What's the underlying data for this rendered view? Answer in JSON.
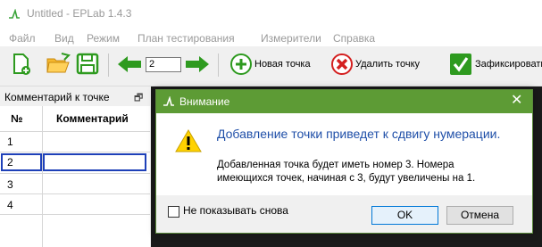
{
  "window": {
    "title": "Untitled - EPLab 1.4.3",
    "icon": "app-logo-icon"
  },
  "menu": [
    "Файл",
    "Вид",
    "Режим",
    "План тестирования",
    "Измерители",
    "Справка"
  ],
  "toolbar": {
    "step_value": "2",
    "add_point_label": "Новая точка",
    "delete_point_label": "Удалить точку",
    "fix_label": "Зафиксировать",
    "icons": [
      "new-file-icon",
      "open-folder-icon",
      "save-icon",
      "arrow-left-icon",
      "arrow-right-icon",
      "add-point-icon",
      "delete-point-icon",
      "checkmark-icon"
    ],
    "colors": {
      "green": "#2e9a1f",
      "red": "#d42020",
      "blue": "#1e40b8"
    }
  },
  "panel": {
    "title": "Комментарий к точке",
    "columns": [
      "№",
      "Комментарий"
    ],
    "rows": [
      {
        "num": "1",
        "comment": ""
      },
      {
        "num": "2",
        "comment": ""
      },
      {
        "num": "3",
        "comment": ""
      },
      {
        "num": "4",
        "comment": ""
      }
    ],
    "selected_row": 2
  },
  "dialog": {
    "title": "Внимание",
    "accent": "#5d9b35",
    "main_message": "Добавление точки приведет к сдвигу нумерации.",
    "detail_line1": "Добавленная точка будет иметь номер 3. Номера",
    "detail_line2": "имеющихся точек, начиная с 3, будут увеличены на 1.",
    "checkbox_label": "Не показывать снова",
    "checkbox_checked": false,
    "ok_label": "OK",
    "cancel_label": "Отмена"
  }
}
